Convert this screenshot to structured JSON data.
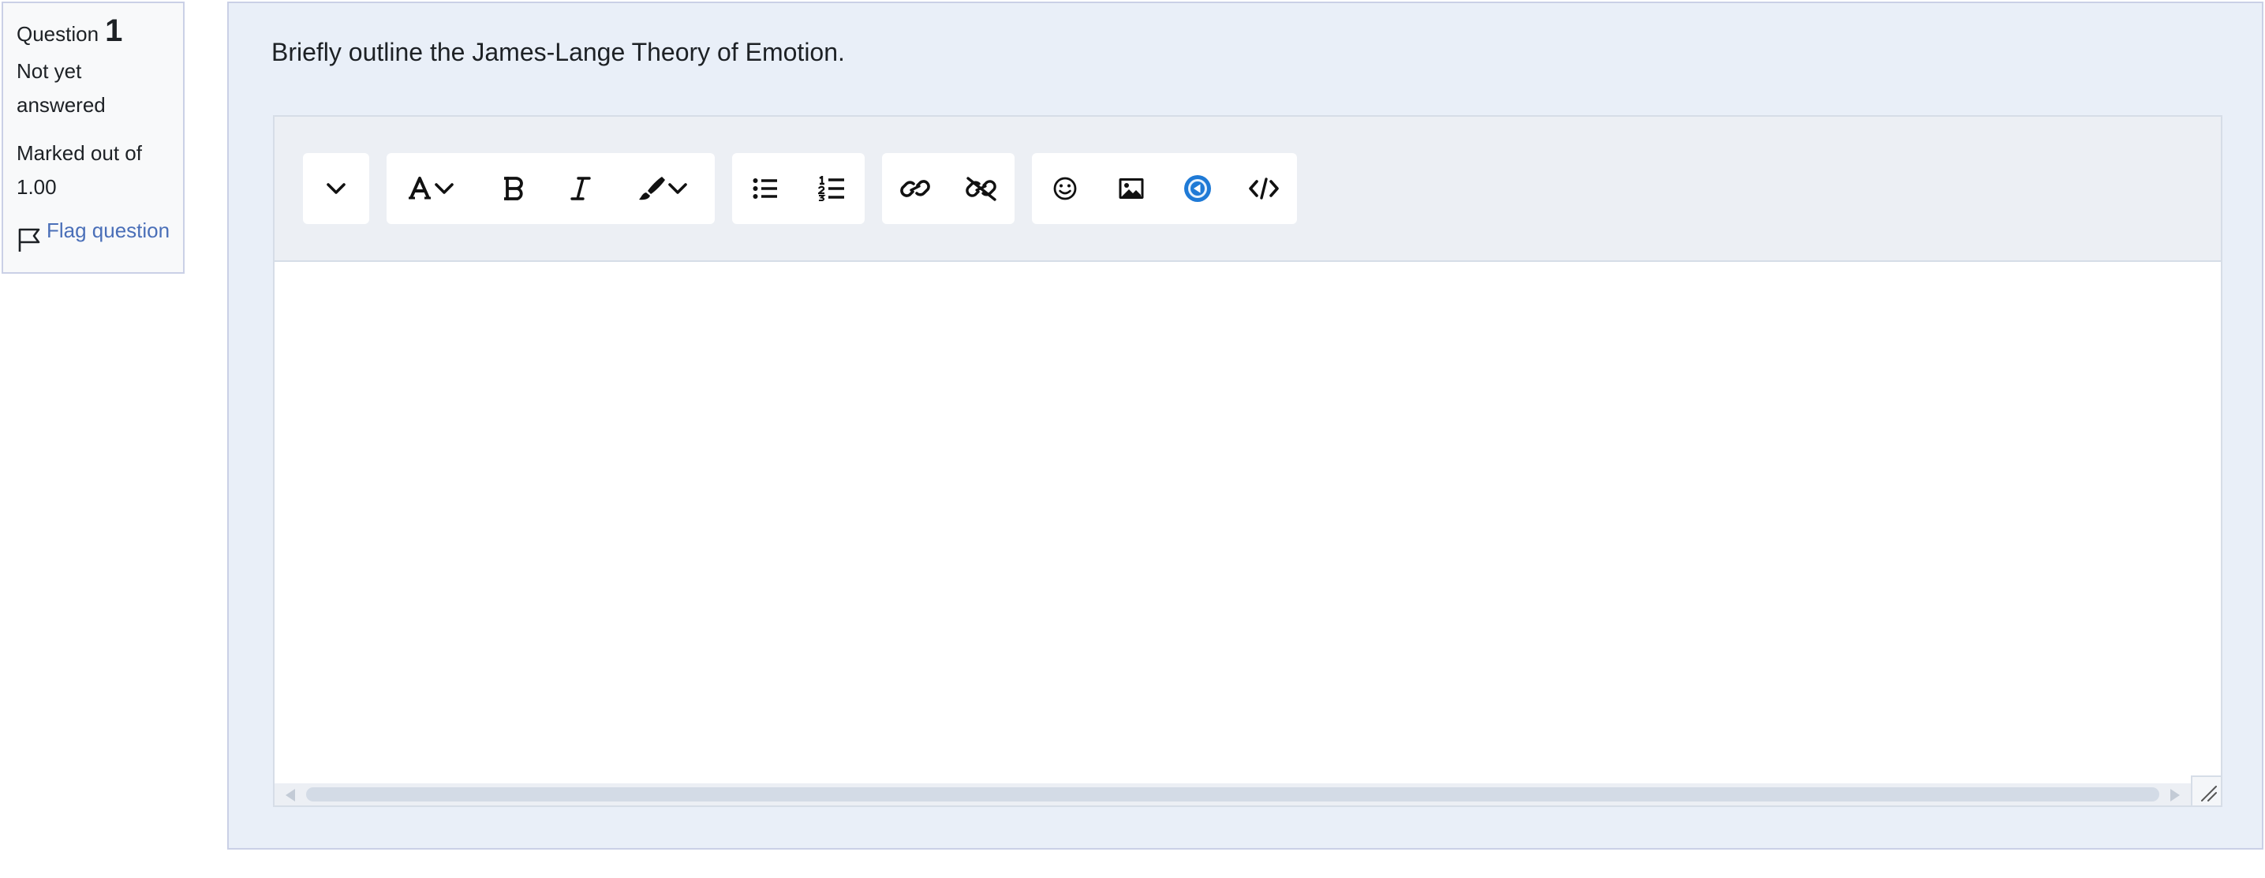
{
  "info": {
    "question_label": "Question",
    "question_number": "1",
    "status": "Not yet answered",
    "marked_label": "Marked out of",
    "marked_value": "1.00",
    "flag_label": "Flag question"
  },
  "question": {
    "text": "Briefly outline the James-Lange Theory of Emotion."
  },
  "toolbar": {
    "groups": [
      [
        "expand-toggle"
      ],
      [
        "font-style",
        "bold",
        "italic",
        "text-color"
      ],
      [
        "unordered-list",
        "ordered-list"
      ],
      [
        "link",
        "unlink"
      ],
      [
        "emoji",
        "image",
        "media",
        "html-source"
      ]
    ]
  },
  "editor": {
    "content": ""
  },
  "colors": {
    "panel_bg": "#e9eff8",
    "panel_border": "#cad0e6",
    "link": "#4a6fb8",
    "toolbar_bg": "#eceff4",
    "media_icon": "#1f7ad6"
  }
}
